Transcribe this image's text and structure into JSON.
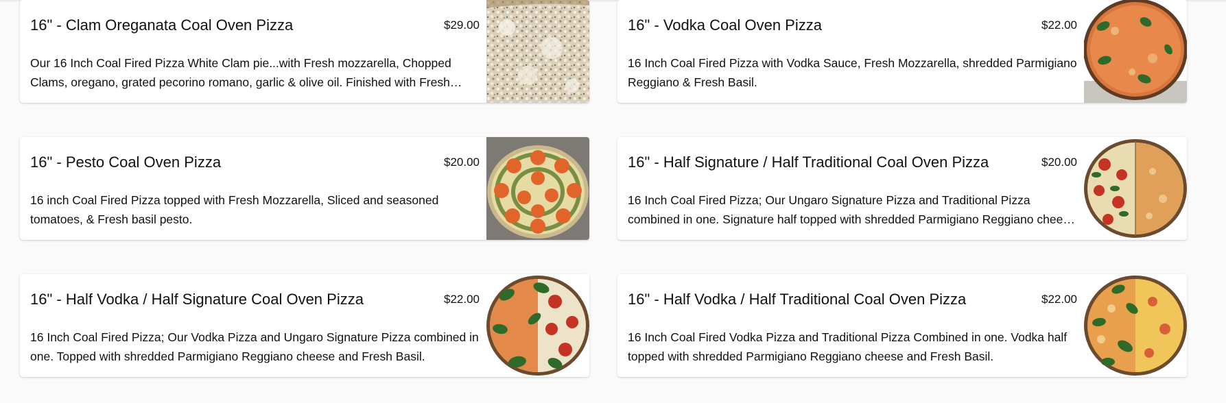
{
  "menu": {
    "items": [
      {
        "name": "16\" - Clam Oreganata Coal Oven Pizza",
        "price": "$29.00",
        "description": "Our 16 Inch Coal Fired Pizza White Clam pie...with Fresh mozzarella, Chopped Clams, oregano, grated pecorino romano, garlic & olive oil. Finished with Fresh Parsley.",
        "photo": "clam-pizza-photo"
      },
      {
        "name": "16\" - Vodka Coal Oven Pizza",
        "price": "$22.00",
        "description": "16 Inch Coal Fired Pizza with Vodka Sauce, Fresh Mozzarella, shredded Parmigiano Reggiano & Fresh Basil.",
        "photo": "vodka-pizza-photo"
      },
      {
        "name": "16\" - Pesto Coal Oven Pizza",
        "price": "$20.00",
        "description": "16 inch Coal Fired Pizza topped with Fresh Mozzarella, Sliced and seasoned tomatoes, & Fresh basil pesto.",
        "photo": "pesto-pizza-photo"
      },
      {
        "name": "16\" - Half Signature / Half Traditional Coal Oven Pizza",
        "price": "$20.00",
        "description": "16 Inch Coal Fired Pizza; Our Ungaro Signature Pizza and Traditional Pizza combined in one. Signature half topped with shredded Parmigiano Reggiano cheese and Fresh Basil.",
        "photo": "half-signature-half-traditional-pizza-photo"
      },
      {
        "name": "16\" - Half Vodka / Half Signature Coal Oven Pizza",
        "price": "$22.00",
        "description": "16 Inch Coal Fired Pizza; Our Vodka Pizza and Ungaro Signature Pizza combined in one. Topped with shredded Parmigiano Reggiano cheese and Fresh Basil.",
        "photo": "half-vodka-half-signature-pizza-photo"
      },
      {
        "name": "16\" - Half Vodka / Half Traditional Coal Oven Pizza",
        "price": "$22.00",
        "description": "16 Inch Coal Fired Vodka Pizza and Traditional Pizza Combined in one. Vodka half topped with shredded Parmigiano Reggiano cheese and Fresh Basil.",
        "photo": "half-vodka-half-traditional-pizza-photo"
      }
    ]
  },
  "colors": {
    "page_background": "#fafafa",
    "card_background": "#ffffff",
    "text": "#111111"
  }
}
